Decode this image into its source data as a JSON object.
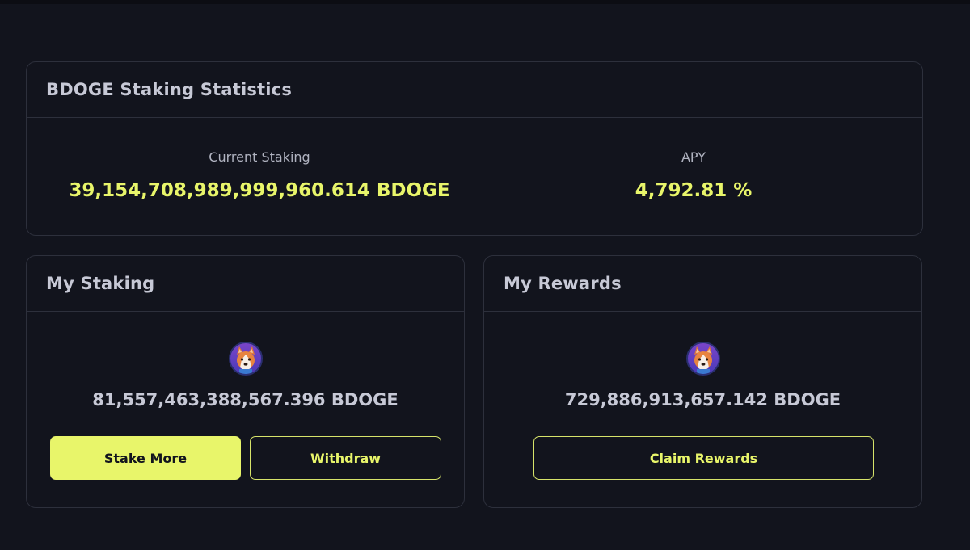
{
  "stats": {
    "title": "BDOGE Staking Statistics",
    "current_staking_label": "Current Staking",
    "current_staking_value": "39,154,708,989,999,960.614 BDOGE",
    "apy_label": "APY",
    "apy_value": "4,792.81 %"
  },
  "my_staking": {
    "title": "My Staking",
    "token_icon": "bdoge-shiba-icon",
    "amount": "81,557,463,388,567.396 BDOGE",
    "stake_more_label": "Stake More",
    "withdraw_label": "Withdraw"
  },
  "my_rewards": {
    "title": "My Rewards",
    "token_icon": "bdoge-shiba-icon",
    "amount": "729,886,913,657.142 BDOGE",
    "claim_label": "Claim Rewards"
  },
  "colors": {
    "background": "#12141d",
    "accent": "#e8f56a",
    "border": "#2d303c",
    "text": "#c7c9d6"
  }
}
